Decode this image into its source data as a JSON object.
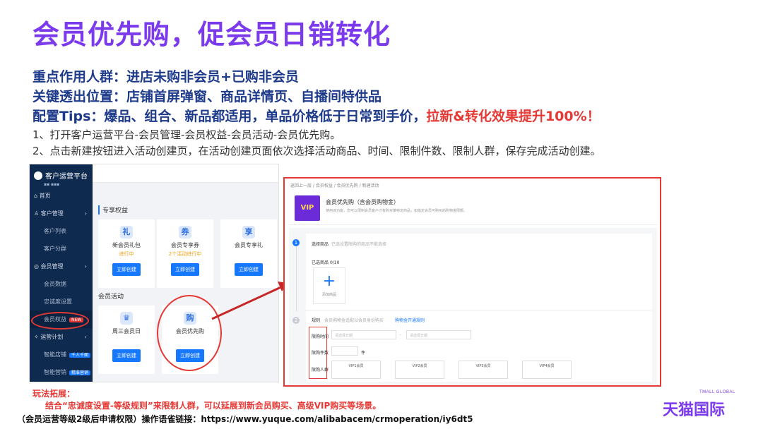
{
  "title": "会员优先购，促会员日销转化",
  "headings": {
    "h1": "重点作用人群：进店未购非会员+已购非会员",
    "h2": "关键透出位置：店铺首屏弹窗、商品详情页、自播间特供品",
    "h3_prefix": "配置Tips：爆品、组合、新品都适用，单品价格低于日常到手价，",
    "h3_highlight": "拉新&转化效果提升100%！"
  },
  "steps": {
    "s1": "1、打开客户运营平台-会员管理-会员权益-会员活动-会员优先购。",
    "s2": "2、点击新建按钮进入活动创建页，在活动创建页面依次选择活动商品、时间、限制件数、限制人群，保存完成活动创建。"
  },
  "crm": {
    "brand": "客户运营平台",
    "sidebar": [
      {
        "label": "首页",
        "icon": "home-icon",
        "sub": false,
        "arrow": false,
        "badge": ""
      },
      {
        "label": "客户管理",
        "icon": "user-icon",
        "sub": false,
        "arrow": true,
        "badge": ""
      },
      {
        "label": "客户列表",
        "icon": "",
        "sub": true,
        "arrow": false,
        "badge": ""
      },
      {
        "label": "客户分群",
        "icon": "",
        "sub": true,
        "arrow": false,
        "badge": ""
      },
      {
        "label": "会员管理",
        "icon": "member-icon",
        "sub": false,
        "arrow": true,
        "badge": ""
      },
      {
        "label": "会员数据",
        "icon": "",
        "sub": true,
        "arrow": false,
        "badge": ""
      },
      {
        "label": "忠诚度设置",
        "icon": "",
        "sub": true,
        "arrow": false,
        "badge": ""
      },
      {
        "label": "会员权益",
        "icon": "",
        "sub": true,
        "arrow": false,
        "badge": "NEW"
      },
      {
        "label": "运营计划",
        "icon": "bulb-icon",
        "sub": false,
        "arrow": true,
        "badge": ""
      },
      {
        "label": "智能店铺",
        "icon": "",
        "sub": true,
        "arrow": false,
        "badge": "千人千面"
      },
      {
        "label": "智能营销",
        "icon": "",
        "sub": true,
        "arrow": false,
        "badge": "精准营销"
      }
    ],
    "section1": "专享权益",
    "section2": "会员活动",
    "cards": [
      {
        "icon": "gift-icon",
        "glyph": "礼",
        "name": "新会员礼包",
        "status": "进行中",
        "button": "立即创建"
      },
      {
        "icon": "coupon-icon",
        "glyph": "券",
        "name": "会员专享券",
        "status": "2个活动进行中",
        "button": "立即创建"
      },
      {
        "icon": "enjoy-icon",
        "glyph": "享",
        "name": "会员专享礼",
        "status": "",
        "button": "立即创建"
      },
      {
        "icon": "crown-icon",
        "glyph": "♛",
        "name": "周三会员日",
        "status": "",
        "button": "立即创建"
      },
      {
        "icon": "bag-icon",
        "glyph": "购",
        "name": "会员优先购",
        "status": "",
        "button": "立即创建"
      }
    ]
  },
  "detail": {
    "breadcrumb": "返回上一层  /  会员权益  /  会员优先购  /  新建活动",
    "vip_badge": "VIP",
    "head_title": "会员优先购（含会员购物金）",
    "head_desc": "使用该功能，您可以限制会员客户才有购买某特定商品，如指定会员可购买的购物金限额。",
    "step1": "1",
    "step1_label": "选择商品",
    "step1_hint": "已选设置限购的商品不能选择",
    "selected_label": "已选商品",
    "selected_count": "0/10",
    "add_plus": "+",
    "add_label": "添加商品",
    "step2": "2",
    "step2_label": "规则",
    "step2_hint": "会员购物金适配以会员身份购买",
    "step2_link": "购物金开通规则",
    "time_label": "限购时间",
    "start_placeholder": "请选择日期",
    "dash": "-",
    "end_placeholder": "请选择日期",
    "count_label": "限购件数",
    "count_unit": "件",
    "crowd_label": "限购人群",
    "levels": [
      "VIP1会员",
      "VIP2会员",
      "VIP3会员",
      "VIP4会员"
    ]
  },
  "footer": {
    "ext_title": "玩法拓展：",
    "ext_text": "结合“忠诚度设置-等级规则”来限制人群，可以延展到新会员购买、高级VIP购买等场景。",
    "link_text": "（会员运营等级2级后申请权限）操作语雀链接：https://www.yuque.com/alibabacem/crmoperation/iy6dt5",
    "brand": "天猫国际",
    "brand_en": "TMALL GLOBAL"
  }
}
